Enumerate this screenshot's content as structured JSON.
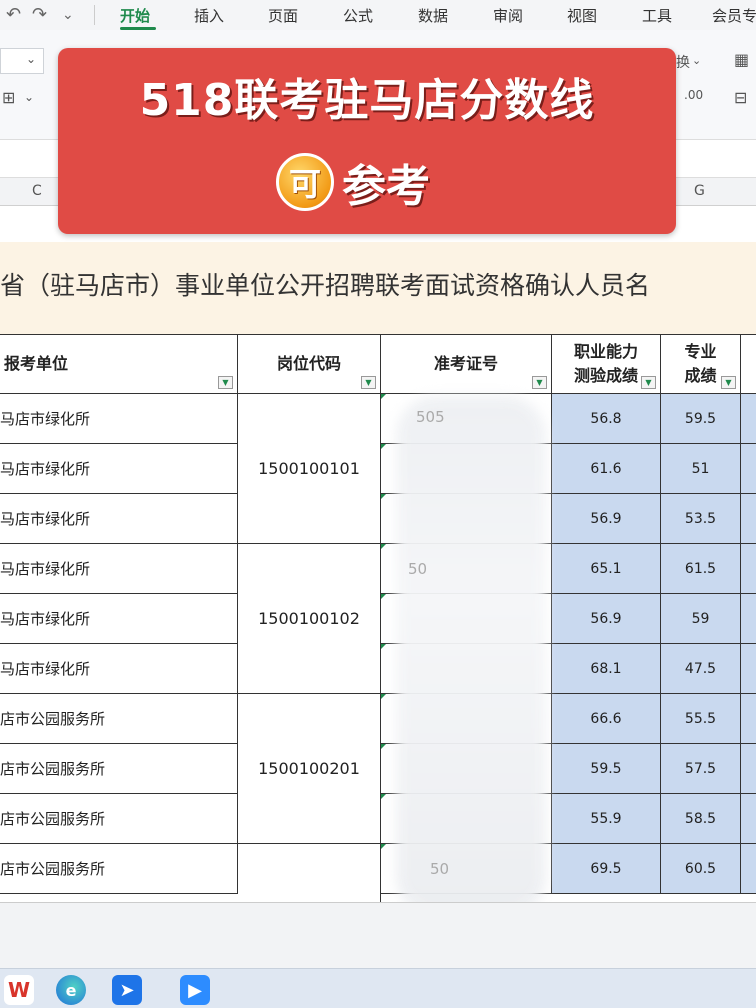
{
  "menubar": {
    "undo_icon": "undo-icon",
    "redo_icon": "redo-icon",
    "items": [
      "开始",
      "插入",
      "页面",
      "公式",
      "数据",
      "审阅",
      "视图",
      "工具",
      "会员专"
    ],
    "active": "开始"
  },
  "ribbon": {
    "fragment_right": "换",
    "fragment_num": ".00"
  },
  "columns": [
    "C",
    "G"
  ],
  "banner": {
    "title": "518联考驻马店分数线",
    "coin_char": "可",
    "sub": "参考"
  },
  "sheet_title": "省（驻马店市）事业单位公开招聘联考面试资格确认人员名",
  "table": {
    "headers": {
      "unit": "报考单位",
      "code": "岗位代码",
      "exam": "准考证号",
      "ability_1": "职业能力",
      "ability_2": "测验成绩",
      "major_1": "专业",
      "major_2": "成绩"
    },
    "rows": [
      {
        "unit": "马店市绿化所",
        "ability": "56.8",
        "major": "59.5"
      },
      {
        "unit": "马店市绿化所",
        "ability": "61.6",
        "major": "51"
      },
      {
        "unit": "马店市绿化所",
        "ability": "56.9",
        "major": "53.5"
      },
      {
        "unit": "马店市绿化所",
        "ability": "65.1",
        "major": "61.5"
      },
      {
        "unit": "马店市绿化所",
        "ability": "56.9",
        "major": "59"
      },
      {
        "unit": "马店市绿化所",
        "ability": "68.1",
        "major": "47.5"
      },
      {
        "unit": "店市公园服务所",
        "ability": "66.6",
        "major": "55.5"
      },
      {
        "unit": "店市公园服务所",
        "ability": "59.5",
        "major": "57.5"
      },
      {
        "unit": "店市公园服务所",
        "ability": "55.9",
        "major": "58.5"
      },
      {
        "unit": "店市公园服务所",
        "ability": "69.5",
        "major": "60.5"
      }
    ],
    "codes": [
      "1500100101",
      "1500100102",
      "1500100201"
    ],
    "exam_fragments": [
      "505",
      "50",
      "50"
    ]
  },
  "taskbar": [
    "wps-icon",
    "edge-icon",
    "feishu-icon",
    "zoom-icon"
  ]
}
